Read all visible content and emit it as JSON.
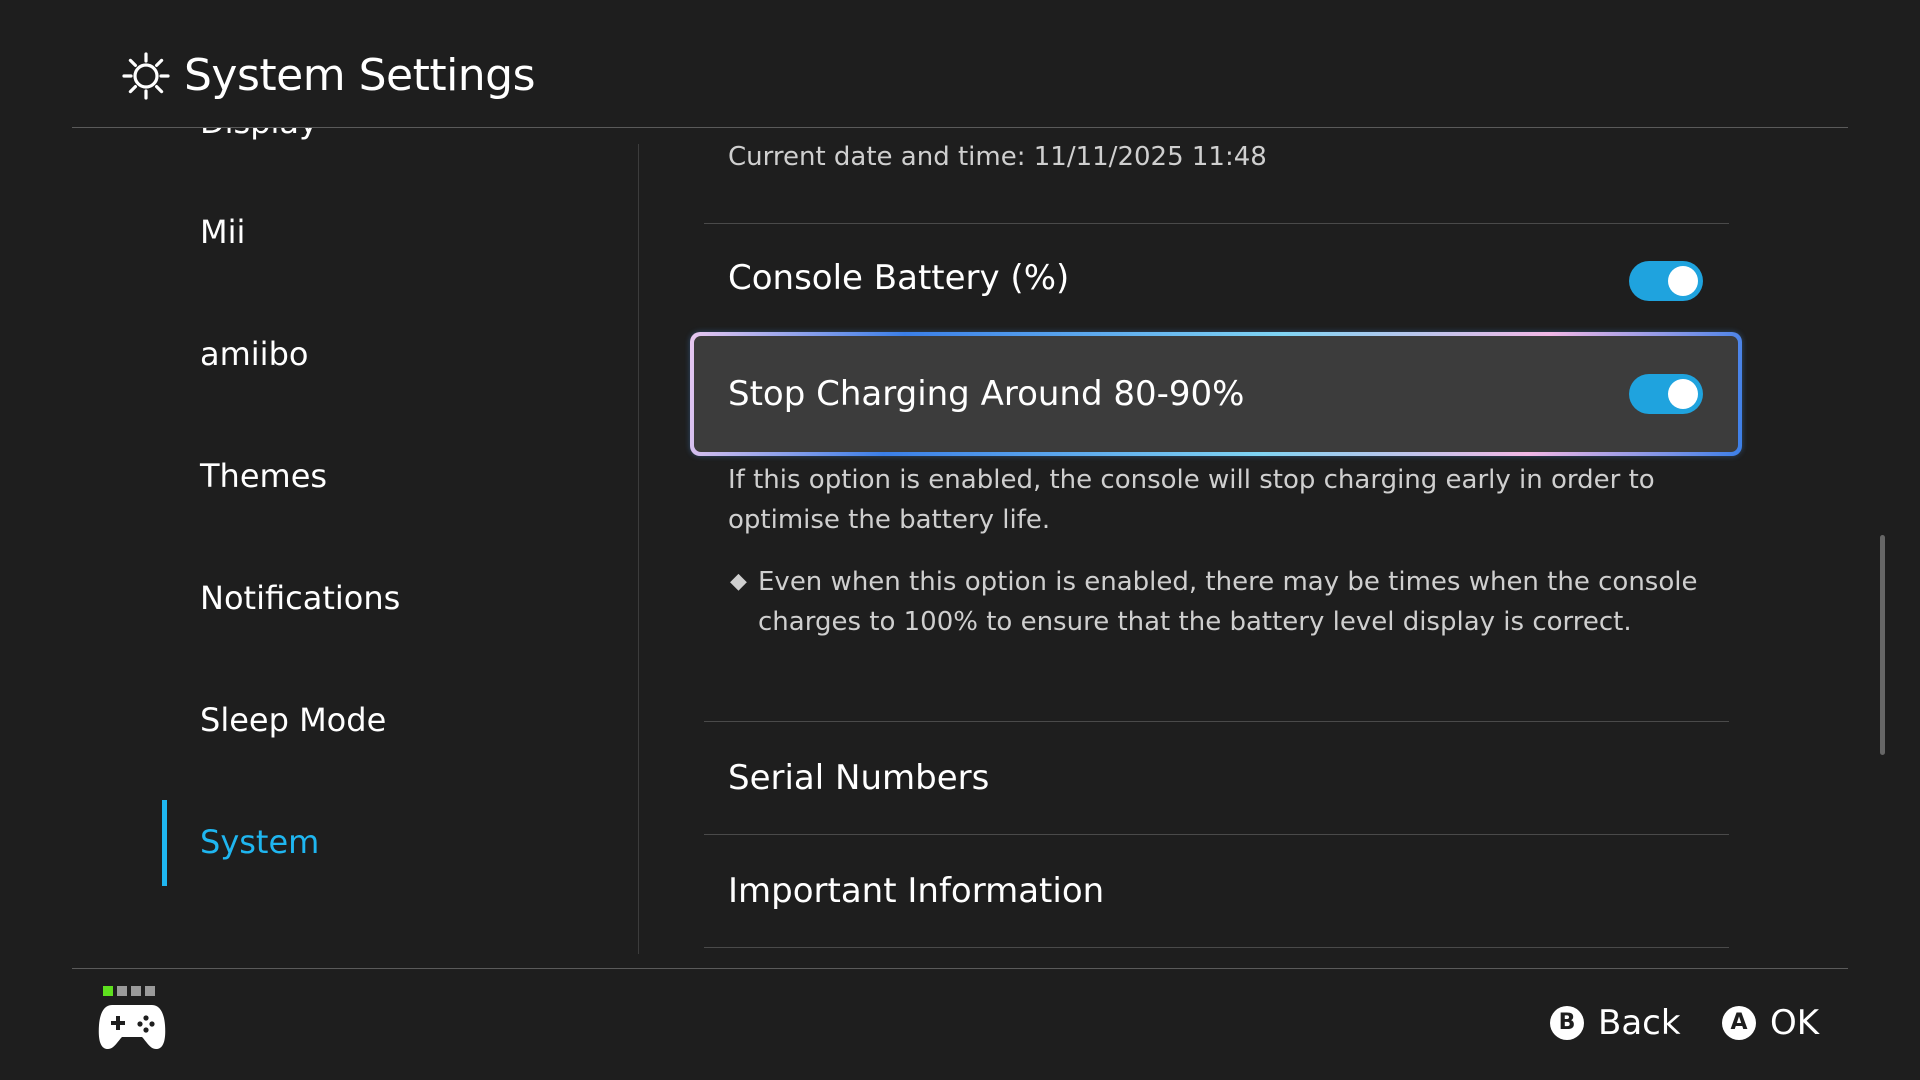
{
  "header": {
    "title": "System Settings",
    "icon": "gear-icon"
  },
  "sidebar": {
    "clipped_item": "Display",
    "items": [
      {
        "label": "Mii"
      },
      {
        "label": "amiibo"
      },
      {
        "label": "Themes"
      },
      {
        "label": "Notifications"
      },
      {
        "label": "Sleep Mode"
      },
      {
        "label": "System",
        "active": true
      }
    ],
    "accent": "#1fb6f0"
  },
  "content": {
    "date_line": "Current date and time: 11/11/2025 11:48",
    "console_battery": {
      "label": "Console Battery (%)",
      "enabled": true
    },
    "stop_charging": {
      "label": "Stop Charging Around 80-90%",
      "enabled": true,
      "desc_1": "If this option is enabled, the console will stop charging early in order to",
      "desc_2": "optimise the battery life.",
      "note_1": "Even when this option is enabled, there may be times when the console",
      "note_2": "charges to 100% to ensure that the battery level display is correct.",
      "note_bullet": "◆"
    },
    "serial_numbers": "Serial Numbers",
    "important_information": "Important Information"
  },
  "footer": {
    "back": {
      "button": "B",
      "label": "Back"
    },
    "ok": {
      "button": "A",
      "label": "OK"
    },
    "player_indicator_active": 1
  },
  "colors": {
    "background": "#1e1e1e",
    "toggle_on": "#1fa3de",
    "selected_row": "#3c3c3c"
  }
}
